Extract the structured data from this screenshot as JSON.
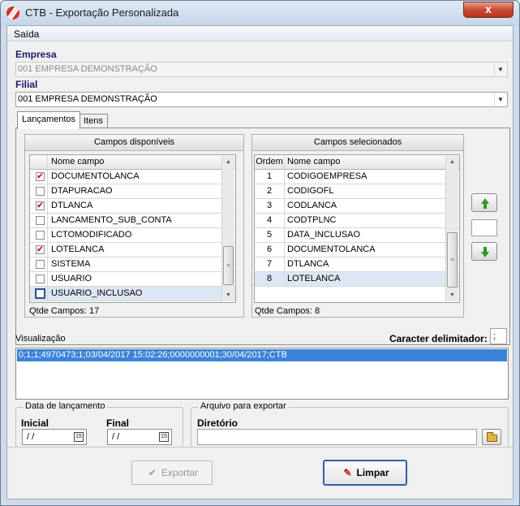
{
  "window": {
    "title": "CTB - Exportação Personalizada",
    "close_glyph": "x"
  },
  "menu": {
    "items": [
      {
        "label": "Saída"
      }
    ]
  },
  "empresa": {
    "label": "Empresa",
    "value": "001 EMPRESA DEMONSTRAÇÃO"
  },
  "filial": {
    "label": "Filial",
    "value": "001 EMPRESA DEMONSTRAÇÃO"
  },
  "tabs": [
    {
      "label": "Lançamentos",
      "active": true
    },
    {
      "label": "Itens",
      "active": false
    }
  ],
  "available": {
    "title": "Campos disponíveis",
    "column_header": "Nome campo",
    "rows": [
      {
        "label": "DOCUMENTOLANCA",
        "checked": true
      },
      {
        "label": "DTAPURACAO",
        "checked": false
      },
      {
        "label": "DTLANCA",
        "checked": true
      },
      {
        "label": "LANCAMENTO_SUB_CONTA",
        "checked": false
      },
      {
        "label": "LCTOMODIFICADO",
        "checked": false
      },
      {
        "label": "LOTELANCA",
        "checked": true
      },
      {
        "label": "SISTEMA",
        "checked": false
      },
      {
        "label": "USUARIO",
        "checked": false
      },
      {
        "label": "USUARIO_INCLUSAO",
        "checked": false,
        "selected": true
      }
    ],
    "count_label": "Qtde Campos: 17"
  },
  "selected": {
    "title": "Campos selecionados",
    "column_order": "Ordem",
    "column_name": "Nome campo",
    "rows": [
      {
        "order": "1",
        "label": "CODIGOEMPRESA"
      },
      {
        "order": "2",
        "label": "CODIGOFL"
      },
      {
        "order": "3",
        "label": "CODLANCA"
      },
      {
        "order": "4",
        "label": "CODTPLNC"
      },
      {
        "order": "5",
        "label": "DATA_INCLUSAO"
      },
      {
        "order": "6",
        "label": "DOCUMENTOLANCA"
      },
      {
        "order": "7",
        "label": "DTLANCA"
      },
      {
        "order": "8",
        "label": "LOTELANCA",
        "selected": true
      }
    ],
    "count_label": "Qtde Campos: 8"
  },
  "preview": {
    "label": "Visualização",
    "line": "0;1;1;4970473;1;03/04/2017 15:02:26;0000000001;30/04/2017;CTB"
  },
  "delimiter": {
    "label": "Caracter delimitador:",
    "value": ";"
  },
  "date_group": {
    "legend": "Data de lançamento",
    "inicial_label": "Inicial",
    "final_label": "Final",
    "inicial_value": " / /",
    "final_value": " / /",
    "cal_glyph": "15"
  },
  "export_group": {
    "legend": "Arquivo para exportar",
    "dir_label": "Diretório",
    "dir_value": ""
  },
  "buttons": {
    "export_label": "Exportar",
    "clear_label": "Limpar"
  },
  "colors": {
    "accent": "#3b83d6",
    "check": "#c0262b",
    "arrow": "#2f9b22"
  }
}
